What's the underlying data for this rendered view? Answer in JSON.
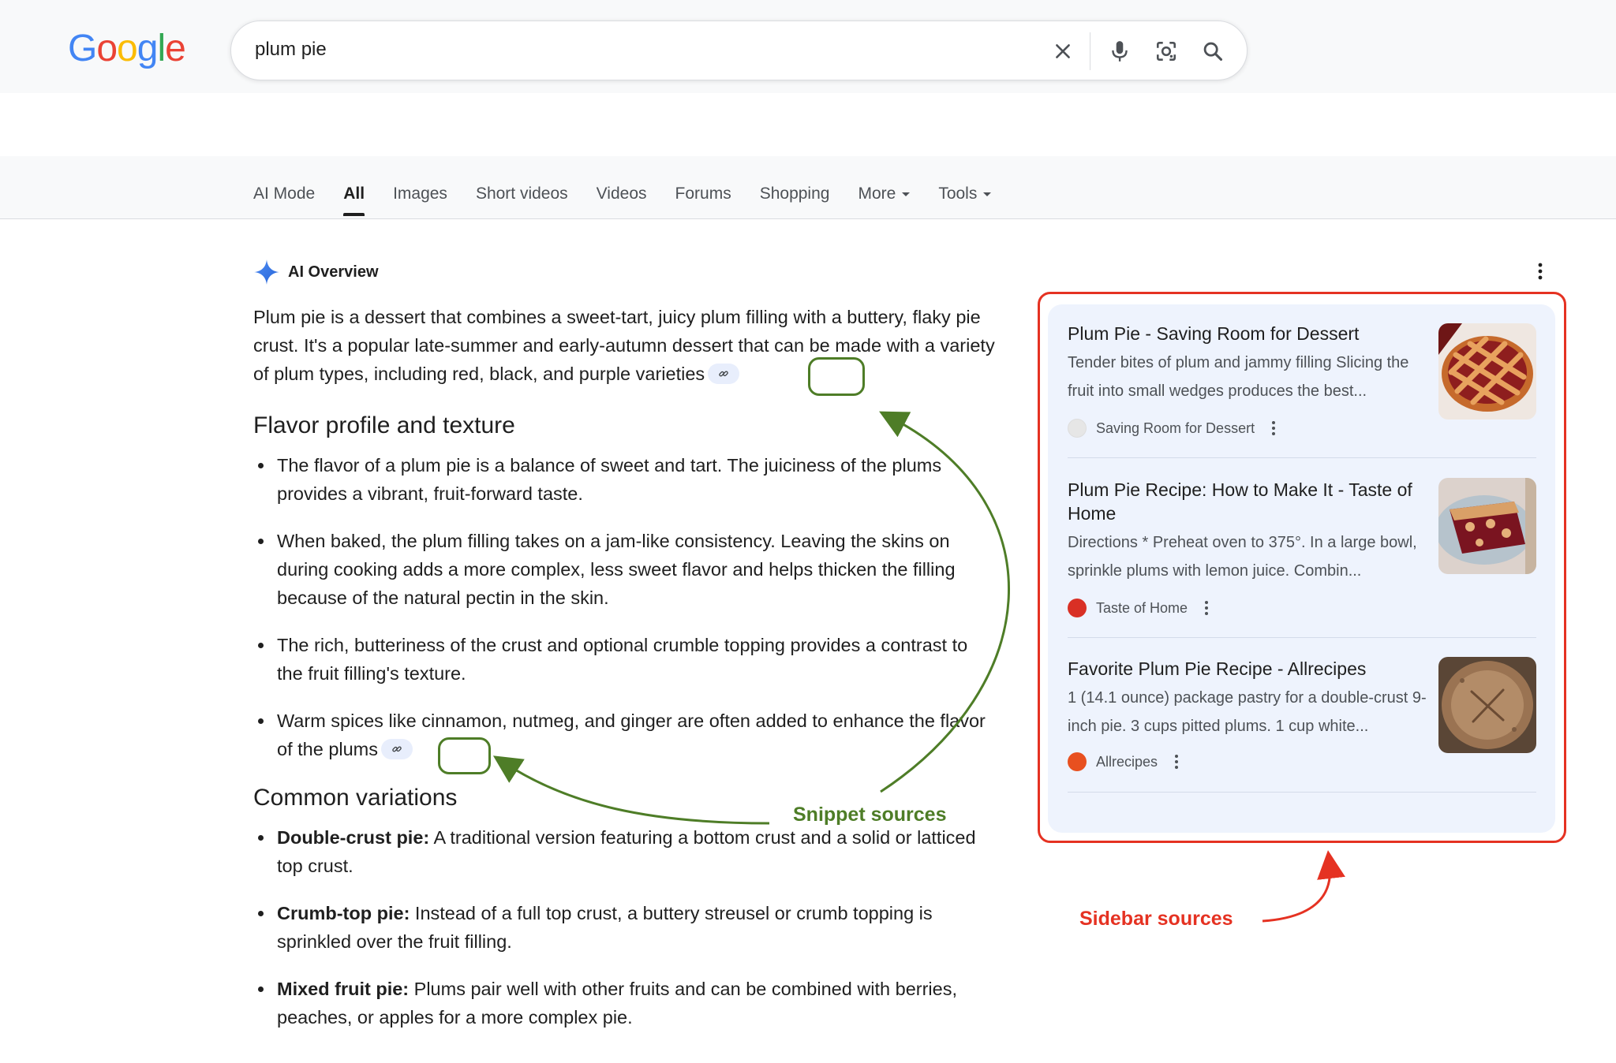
{
  "header": {
    "logo_letters": [
      {
        "ch": "G",
        "color": "#4285F4"
      },
      {
        "ch": "o",
        "color": "#EA4335"
      },
      {
        "ch": "o",
        "color": "#FBBC05"
      },
      {
        "ch": "g",
        "color": "#4285F4"
      },
      {
        "ch": "l",
        "color": "#34A853"
      },
      {
        "ch": "e",
        "color": "#EA4335"
      }
    ],
    "search_value": "plum pie",
    "icons": [
      "close-icon",
      "mic-icon",
      "lens-camera-icon",
      "search-icon"
    ]
  },
  "tabs": [
    {
      "label": "AI Mode"
    },
    {
      "label": "All",
      "active": true
    },
    {
      "label": "Images"
    },
    {
      "label": "Short videos"
    },
    {
      "label": "Videos"
    },
    {
      "label": "Forums"
    },
    {
      "label": "Shopping"
    },
    {
      "label": "More",
      "dropdown": true
    },
    {
      "label": "Tools",
      "dropdown": true
    }
  ],
  "ai_overview": {
    "title": "AI Overview",
    "intro": "Plum pie is a dessert that combines a sweet-tart, juicy plum filling with a buttery, flaky pie crust. It's a popular late-summer and early-autumn dessert that can be made with a variety of plum types, including red, black, and purple varieties",
    "flavor_heading": "Flavor profile and texture",
    "flavor_items": [
      "The flavor of a plum pie is a balance of sweet and tart. The juiciness of the plums provides a vibrant, fruit-forward taste.",
      "When baked, the plum filling takes on a jam-like consistency. Leaving the skins on during cooking adds a more complex, less sweet flavor and helps thicken the filling because of the natural pectin in the skin.",
      "The rich, butteriness of the crust and optional crumble topping provides a contrast to the fruit filling's texture.",
      "Warm spices like cinnamon, nutmeg, and ginger are often added to enhance the flavor of the plums"
    ],
    "variations_heading": "Common variations",
    "variations": [
      {
        "term": "Double-crust pie:",
        "text": " A traditional version featuring a bottom crust and a solid or latticed top crust."
      },
      {
        "term": "Crumb-top pie:",
        "text": " Instead of a full top crust, a buttery streusel or crumb topping is sprinkled over the fruit filling."
      },
      {
        "term": "Mixed fruit pie:",
        "text": " Plums pair well with other fruits and can be combined with berries, peaches, or apples for a more complex pie."
      }
    ]
  },
  "sidebar": {
    "cards": [
      {
        "title": "Plum Pie - Saving Room for Dessert",
        "snippet": "Tender bites of plum and jammy filling Slicing the fruit into small wedges produces the best...",
        "source": "Saving Room for Dessert",
        "favicon_color": "#e6e6e6"
      },
      {
        "title": "Plum Pie Recipe: How to Make It - Taste of Home",
        "snippet": "Directions * Preheat oven to 375°. In a large bowl, sprinkle plums with lemon juice. Combin...",
        "source": "Taste of Home",
        "favicon_color": "#d93025"
      },
      {
        "title": "Favorite Plum Pie Recipe - Allrecipes",
        "snippet": "1 (14.1 ounce) package pastry for a double-crust 9-inch pie. 3 cups pitted plums. 1 cup white...",
        "source": "Allrecipes",
        "favicon_color": "#e8501f"
      }
    ]
  },
  "annotations": {
    "snippet_sources": "Snippet sources",
    "sidebar_sources": "Sidebar sources",
    "green": "#4e7d27",
    "red": "#e53222"
  }
}
